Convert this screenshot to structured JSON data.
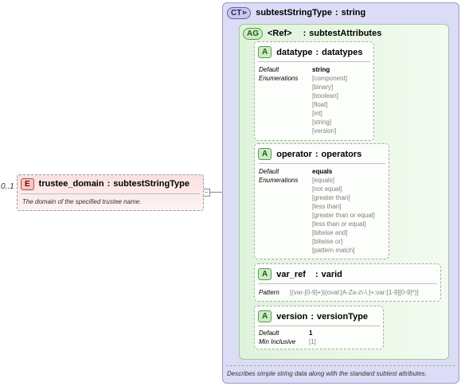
{
  "element": {
    "occurrence": "0..1",
    "tag": "E",
    "name": "trustee_domain",
    "type": "subtestStringType",
    "documentation": "The domain of the specified trustee name."
  },
  "complex_type": {
    "tag": "CT",
    "name": "subtestStringType",
    "base": "string",
    "documentation": "Describes simple string data along with the standard subtest attributes."
  },
  "attribute_group": {
    "tag": "AG",
    "ref_label": "<Ref>",
    "name": "subtestAttributes"
  },
  "attributes": {
    "datatype": {
      "tag": "A",
      "name": "datatype",
      "type": "datatypes",
      "default_label": "Default",
      "enum_label": "Enumerations",
      "default_value": "string",
      "enumerations": [
        "[component]",
        "[binary]",
        "[boolean]",
        "[float]",
        "[int]",
        "[string]",
        "[version]"
      ]
    },
    "operator": {
      "tag": "A",
      "name": "operator",
      "type": "operators",
      "default_label": "Default",
      "enum_label": "Enumerations",
      "default_value": "equals",
      "enumerations": [
        "[equals]",
        "[not equal]",
        "[greater than]",
        "[less than]",
        "[greater than or equal]",
        "[less than or equal]",
        "[bitwise and]",
        "[bitwise or]",
        "[pattern match]"
      ]
    },
    "var_ref": {
      "tag": "A",
      "name": "var_ref",
      "type": "varid",
      "pattern_label": "Pattern",
      "pattern_value": "[(var-[0-9]+)|(oval:[A-Za-z\\-\\.]+:var:[1-9][0-9]*)]"
    },
    "version": {
      "tag": "A",
      "name": "version",
      "type": "versionType",
      "default_label": "Default",
      "min_label": "Min Inclusive",
      "default_value": "1",
      "min_value": "[1]"
    }
  }
}
